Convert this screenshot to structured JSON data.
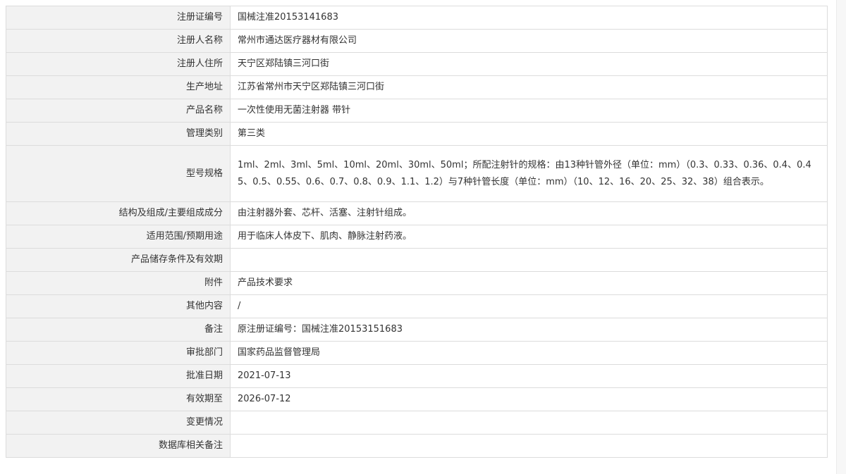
{
  "rows": [
    {
      "label": "注册证编号",
      "value": "国械注准20153141683"
    },
    {
      "label": "注册人名称",
      "value": "常州市通达医疗器材有限公司"
    },
    {
      "label": "注册人住所",
      "value": "天宁区郑陆镇三河口街"
    },
    {
      "label": "生产地址",
      "value": "江苏省常州市天宁区郑陆镇三河口街"
    },
    {
      "label": "产品名称",
      "value": "一次性使用无菌注射器 带针"
    },
    {
      "label": "管理类别",
      "value": "第三类"
    },
    {
      "label": "型号规格",
      "value": "1ml、2ml、3ml、5ml、10ml、20ml、30ml、50ml；所配注射针的规格：由13种针管外径（单位：mm）（0.3、0.33、0.36、0.4、0.45、0.5、0.55、0.6、0.7、0.8、0.9、1.1、1.2）与7种针管长度（单位：mm）（10、12、16、20、25、32、38）组合表示。"
    },
    {
      "label": "结构及组成/主要组成成分",
      "value": "由注射器外套、芯杆、活塞、注射针组成。"
    },
    {
      "label": "适用范围/预期用途",
      "value": "用于临床人体皮下、肌肉、静脉注射药液。"
    },
    {
      "label": "产品储存条件及有效期",
      "value": ""
    },
    {
      "label": "附件",
      "value": "产品技术要求"
    },
    {
      "label": "其他内容",
      "value": "/"
    },
    {
      "label": "备注",
      "value": "原注册证编号：国械注准20153151683"
    },
    {
      "label": "审批部门",
      "value": "国家药品监督管理局"
    },
    {
      "label": "批准日期",
      "value": "2021-07-13"
    },
    {
      "label": "有效期至",
      "value": "2026-07-12"
    },
    {
      "label": "变更情况",
      "value": ""
    },
    {
      "label": "数据库相关备注",
      "value": ""
    }
  ]
}
